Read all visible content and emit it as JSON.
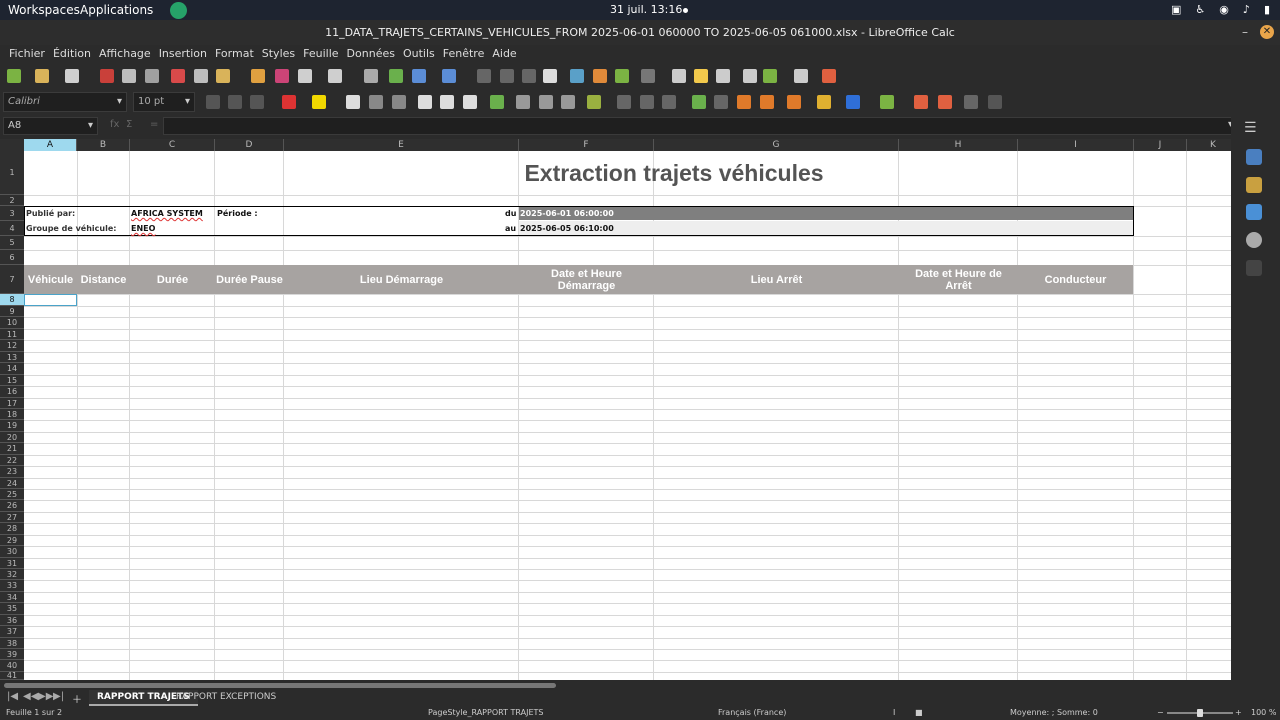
{
  "system_bar": {
    "workspaces": "Workspaces",
    "applications": "Applications",
    "clock": "31 juil.  13:16"
  },
  "window": {
    "title": "11_DATA_TRAJETS_CERTAINS_VEHICULES_FROM 2025-06-01 060000 TO 2025-06-05 061000.xlsx - LibreOffice Calc"
  },
  "menu": [
    "Fichier",
    "Édition",
    "Affichage",
    "Insertion",
    "Format",
    "Styles",
    "Feuille",
    "Données",
    "Outils",
    "Fenêtre",
    "Aide"
  ],
  "format_toolbar": {
    "font_name": "Calibri",
    "font_size": "10 pt"
  },
  "formula_bar": {
    "name_box": "A8",
    "content": ""
  },
  "columns": [
    "A",
    "B",
    "C",
    "D",
    "E",
    "F",
    "G",
    "H",
    "I",
    "J",
    "K"
  ],
  "rows": [
    "1",
    "2",
    "3",
    "4",
    "5",
    "6",
    "7",
    "8",
    "9",
    "10",
    "11",
    "12",
    "13",
    "14",
    "15",
    "16",
    "17",
    "18",
    "19",
    "20",
    "21",
    "22",
    "23",
    "24",
    "25",
    "26",
    "27",
    "28",
    "29",
    "30",
    "31",
    "32",
    "33",
    "34",
    "35",
    "36",
    "37",
    "38",
    "39",
    "40",
    "41"
  ],
  "sheet": {
    "title": "Extraction trajets véhicules",
    "publie_label": "Publié par:",
    "publie_value": "AFRICA SYSTEM",
    "periode_label": "Période :",
    "du_label": "du",
    "du_value": "2025-06-01 06:00:00",
    "groupe_label": "Groupe de véhicule:",
    "groupe_value": "ENEO",
    "au_label": "au",
    "au_value": "2025-06-05 06:10:00",
    "headers": [
      "Véhicule",
      "Distance",
      "Durée",
      "Durée Pause",
      "Lieu Démarrage",
      "Date et Heure Démarrage",
      "Lieu Arrêt",
      "Date et Heure de Arrêt",
      "Conducteur"
    ]
  },
  "tabs": [
    "RAPPORT TRAJETS",
    "RAPPORT EXCEPTIONS"
  ],
  "status": {
    "sheet": "Feuille 1 sur 2",
    "pagestyle": "PageStyle_RAPPORT TRAJETS",
    "language": "Français (France)",
    "sum": "Moyenne: ; Somme: 0",
    "zoom": "100 %"
  }
}
